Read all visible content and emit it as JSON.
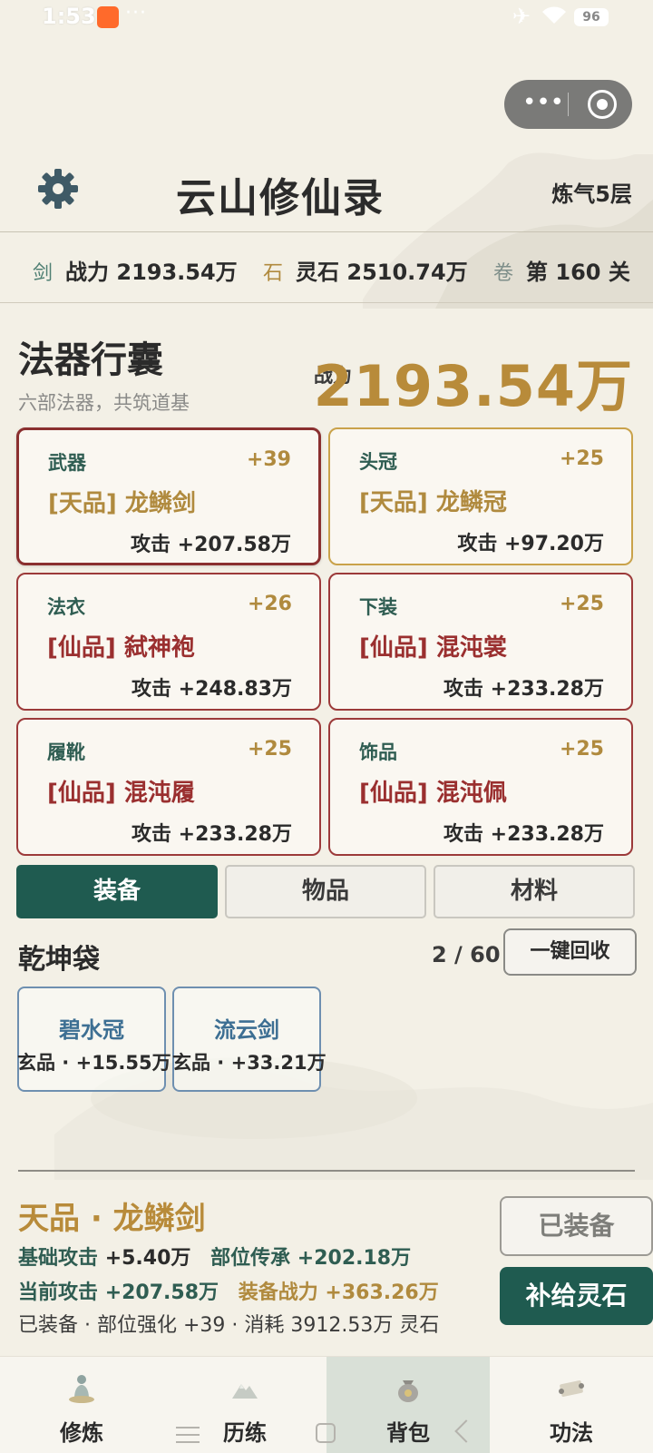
{
  "status_bar": {
    "time": "1:53",
    "dots": "···",
    "battery": "96"
  },
  "header": {
    "title": "云山修仙录",
    "realm": "炼气5层"
  },
  "stats": [
    {
      "glyph": "剑",
      "text": "战力 2193.54万"
    },
    {
      "glyph": "石",
      "text": "灵石 2510.74万"
    },
    {
      "glyph": "卷",
      "text": "第 160 关"
    }
  ],
  "section": {
    "title": "法器行囊",
    "subtitle": "六部法器，共筑道基",
    "power_label": "战力",
    "power_value": "2193.54万"
  },
  "equipment": [
    {
      "slot": "武器",
      "level": "+39",
      "name": "[天品] 龙鳞剑",
      "attack": "攻击 +207.58万"
    },
    {
      "slot": "头冠",
      "level": "+25",
      "name": "[天品] 龙鳞冠",
      "attack": "攻击 +97.20万"
    },
    {
      "slot": "法衣",
      "level": "+26",
      "name": "[仙品] 弑神袍",
      "attack": "攻击 +248.83万"
    },
    {
      "slot": "下装",
      "level": "+25",
      "name": "[仙品] 混沌裳",
      "attack": "攻击 +233.28万"
    },
    {
      "slot": "履靴",
      "level": "+25",
      "name": "[仙品] 混沌履",
      "attack": "攻击 +233.28万"
    },
    {
      "slot": "饰品",
      "level": "+25",
      "name": "[仙品] 混沌佩",
      "attack": "攻击 +233.28万"
    }
  ],
  "tabs": [
    "装备",
    "物品",
    "材料"
  ],
  "bag": {
    "title": "乾坤袋",
    "count": "2 / 60",
    "recycle_label": "一键回收",
    "items": [
      {
        "name": "碧水冠",
        "stat": "玄品 · +15.55万"
      },
      {
        "name": "流云剑",
        "stat": "玄品 · +33.21万"
      }
    ]
  },
  "detail": {
    "title": "天品 · 龙鳞剑",
    "base_attack_label": "基础攻击",
    "base_attack_value": "+5.40万",
    "inherit_label": "部位传承",
    "inherit_value": "+202.18万",
    "current_attack_label": "当前攻击",
    "current_attack_value": "+207.58万",
    "equip_power_label": "装备战力",
    "equip_power_value": "+363.26万",
    "info": "已装备 · 部位强化 +39 · 消耗 3912.53万 灵石",
    "equipped_button": "已装备",
    "supply_button": "补给灵石"
  },
  "nav": [
    "修炼",
    "历练",
    "背包",
    "功法"
  ],
  "colors": {
    "accent_green": "#1f5b50",
    "gold": "#b88b3a",
    "xian_red": "#9a2f2f",
    "xuan_blue": "#3d6f93"
  },
  "icons": [
    "settings-gear-icon",
    "meditation-icon",
    "mountain-icon",
    "treasure-bag-icon",
    "scroll-icon"
  ]
}
